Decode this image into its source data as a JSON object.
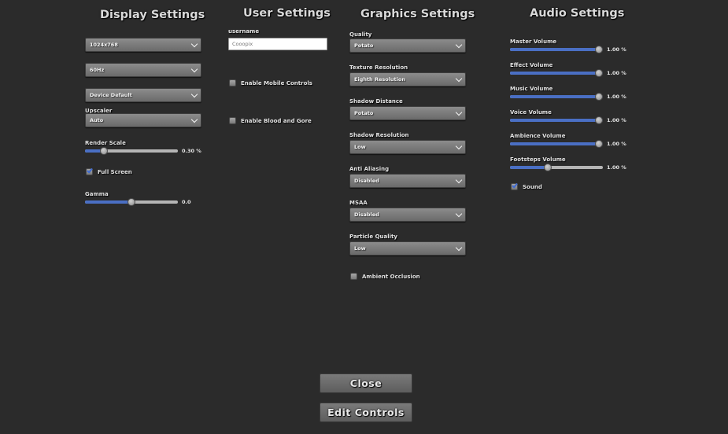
{
  "display": {
    "title": "Display Settings",
    "resolution": "1024x768",
    "refresh_rate": "60Hz",
    "device": "Device Default",
    "upscaler_label": "Upscaler",
    "upscaler": "Auto",
    "render_scale_label": "Render Scale",
    "render_scale_value": "0.30 %",
    "render_scale_fraction": 0.18,
    "fullscreen_label": "Full Screen",
    "fullscreen_checked": true,
    "gamma_label": "Gamma",
    "gamma_value": "0.0",
    "gamma_fraction": 0.5
  },
  "user": {
    "title": "User Settings",
    "username_label": "username",
    "username_placeholder": "Cooopix",
    "mobile_controls_label": "Enable Mobile Controls",
    "mobile_controls_checked": false,
    "blood_gore_label": "Enable Blood and Gore",
    "blood_gore_checked": false
  },
  "graphics": {
    "title": "Graphics Settings",
    "quality_label": "Quality",
    "quality": "Potato",
    "texture_label": "Texture Resolution",
    "texture": "Eighth Resolution",
    "shadow_distance_label": "Shadow Distance",
    "shadow_distance": "Potato",
    "shadow_resolution_label": "Shadow Resolution",
    "shadow_resolution": "Low",
    "antialiasing_label": "Anti Aliasing",
    "antialiasing": "Disabled",
    "msaa_label": "MSAA",
    "msaa": "Disabled",
    "particle_label": "Particle Quality",
    "particle": "Low",
    "ambient_occlusion_label": "Ambient Occlusion",
    "ambient_occlusion_checked": false
  },
  "audio": {
    "title": "Audio Settings",
    "sliders": [
      {
        "label": "Master Volume",
        "value": "1.00 %",
        "fraction": 1.0
      },
      {
        "label": "Effect Volume",
        "value": "1.00 %",
        "fraction": 1.0
      },
      {
        "label": "Music Volume",
        "value": "1.00 %",
        "fraction": 1.0
      },
      {
        "label": "Voice Volume",
        "value": "1.00 %",
        "fraction": 1.0
      },
      {
        "label": "Ambience Volume",
        "value": "1.00 %",
        "fraction": 1.0
      },
      {
        "label": "Footsteps Volume",
        "value": "1.00 %",
        "fraction": 0.4
      }
    ],
    "sound_label": "Sound",
    "sound_checked": true
  },
  "buttons": {
    "close": "Close",
    "edit_controls": "Edit Controls"
  },
  "colors": {
    "background": "#2b2b2b",
    "slider_fill": "#4a6fc4",
    "check": "#3f6bd1"
  }
}
